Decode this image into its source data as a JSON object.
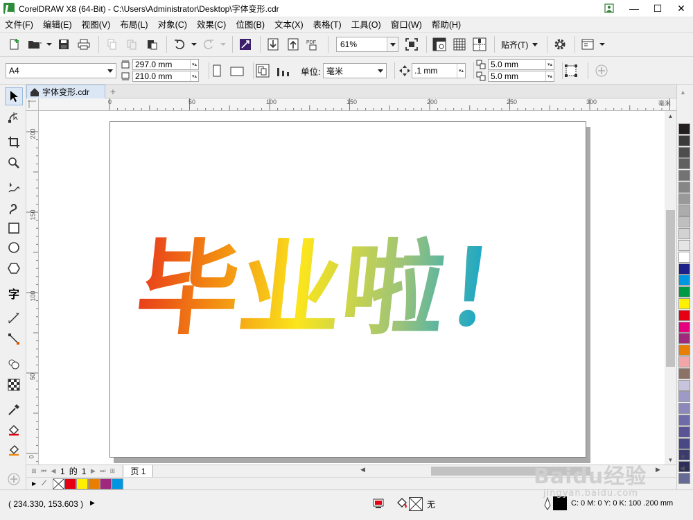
{
  "window": {
    "title": "CorelDRAW X8 (64-Bit) - C:\\Users\\Administrator\\Desktop\\字体变形.cdr",
    "minimize": "—",
    "maximize": "☐",
    "close": "✕"
  },
  "menu": [
    {
      "label": "文件(F)"
    },
    {
      "label": "编辑(E)"
    },
    {
      "label": "视图(V)"
    },
    {
      "label": "布局(L)"
    },
    {
      "label": "对象(C)"
    },
    {
      "label": "效果(C)"
    },
    {
      "label": "位图(B)"
    },
    {
      "label": "文本(X)"
    },
    {
      "label": "表格(T)"
    },
    {
      "label": "工具(O)"
    },
    {
      "label": "窗口(W)"
    },
    {
      "label": "帮助(H)"
    }
  ],
  "toolbar": {
    "zoom": "61%",
    "snap_label": "贴齐(T)",
    "pdf_label": "PDF"
  },
  "propbar": {
    "page_size": "A4",
    "width": "297.0 mm",
    "height": "210.0 mm",
    "unit_label": "单位:",
    "unit_value": "毫米",
    "nudge": ".1 mm",
    "dup_x": "5.0 mm",
    "dup_y": "5.0 mm"
  },
  "document": {
    "tab_label": "字体变形.cdr",
    "artwork_text": "毕业啦！",
    "gradient_colors": [
      "#e8381b",
      "#f28a12",
      "#fbe51c",
      "#9bc37a",
      "#1ba7c8",
      "#129be2"
    ]
  },
  "ruler": {
    "unit": "毫米",
    "h_ticks": [
      "0",
      "50",
      "100",
      "150",
      "200",
      "250",
      "300"
    ],
    "v_ticks": [
      "200",
      "150",
      "100",
      "50",
      "0"
    ]
  },
  "page_nav": {
    "current": "1",
    "of_label": "的",
    "total": "1",
    "page_tab": "页 1"
  },
  "palette_colors": [
    "#231f20",
    "#3a3a3a",
    "#4d4d4d",
    "#606060",
    "#737373",
    "#868686",
    "#999999",
    "#acacac",
    "#bfbfbf",
    "#d2d2d2",
    "#e5e5e5",
    "#ffffff",
    "#1d2088",
    "#0097e0",
    "#009944",
    "#fff100",
    "#e60012",
    "#e4007f",
    "#a0287d",
    "#e87e04",
    "#f3a6a8",
    "#8b7265",
    "#c9c4dd",
    "#9e9ac8",
    "#8c88bd",
    "#6f6aa8",
    "#5a5496",
    "#484885",
    "#3b3b6e",
    "#2e2e5c",
    "#666a96"
  ],
  "doc_palette_colors": [
    "#e60012",
    "#fff100",
    "#e87e04",
    "#a0287d",
    "#0097e0"
  ],
  "status": {
    "coords": "( 234.330, 153.603 )",
    "fill_none_label": "无",
    "outline_info": "C: 0 M: 0 Y: 0 K: 100  .200 mm"
  },
  "watermark": {
    "brand": "Baidu经验",
    "url": "jingyan.baidu.com"
  }
}
